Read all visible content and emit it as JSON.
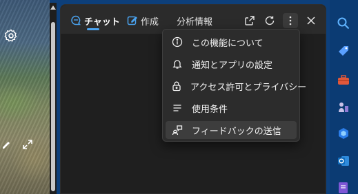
{
  "tabs": [
    {
      "label": "チャット",
      "active": true,
      "icon": "chat-icon"
    },
    {
      "label": "作成",
      "active": false,
      "icon": "compose-icon"
    },
    {
      "label": "分析情報",
      "active": false,
      "icon": ""
    }
  ],
  "header_buttons": [
    "open-external-icon",
    "refresh-icon",
    "more-options-icon",
    "close-icon"
  ],
  "menu": {
    "items": [
      {
        "label": "この機能について",
        "icon": "info-icon"
      },
      {
        "label": "通知とアプリの設定",
        "icon": "bell-icon"
      },
      {
        "label": "アクセス許可とプライバシー",
        "icon": "lock-icon"
      },
      {
        "label": "使用条件",
        "icon": "list-icon"
      },
      {
        "label": "フィードバックの送信",
        "icon": "feedback-icon",
        "highlighted": true
      }
    ]
  },
  "taskbar_icons": [
    "search-icon",
    "tag-icon",
    "toolbox-icon",
    "chess-icon",
    "copilot-icon",
    "outlook-icon",
    "notes-icon"
  ],
  "colors": {
    "panel_bg": "#1f1f1f",
    "menu_bg": "#2c2c2c",
    "accent": "#4aa3f0",
    "taskbar": "#0b3b73"
  }
}
